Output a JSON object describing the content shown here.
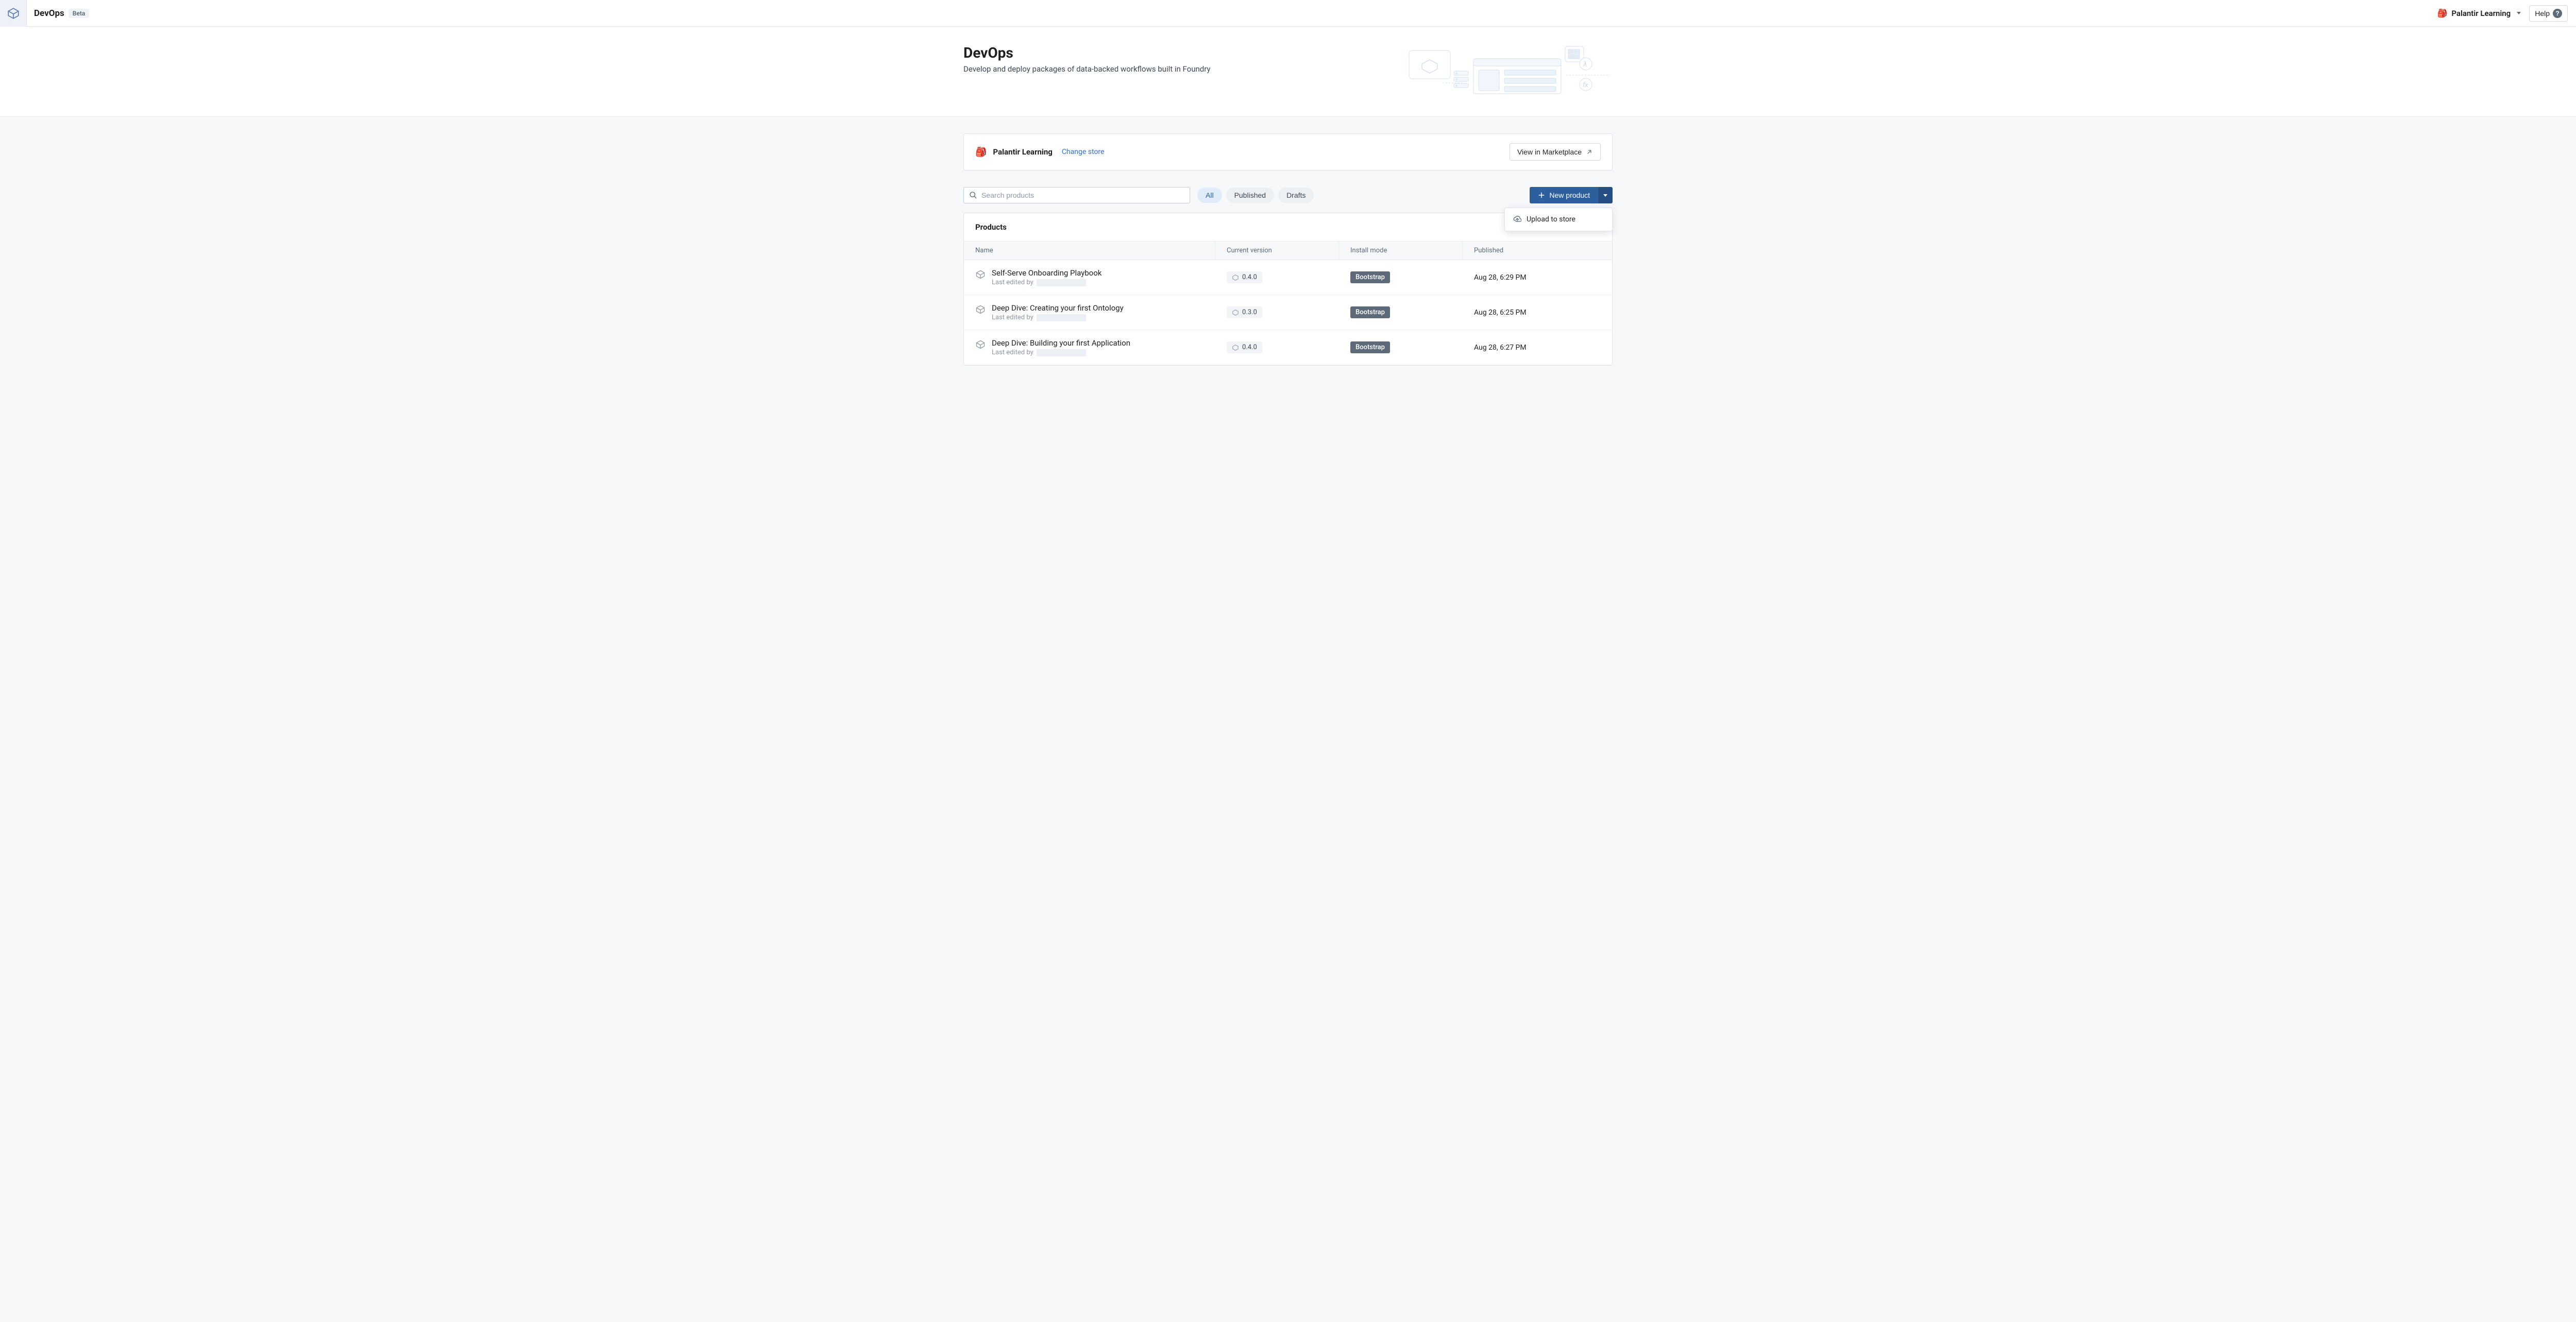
{
  "header": {
    "app_name": "DevOps",
    "beta_label": "Beta",
    "org_name": "Palantir Learning",
    "help_label": "Help"
  },
  "hero": {
    "title": "DevOps",
    "subtitle": "Develop and deploy packages of data-backed workflows built in Foundry"
  },
  "store_banner": {
    "store_name": "Palantir Learning",
    "change_store_label": "Change store",
    "view_marketplace_label": "View in Marketplace"
  },
  "toolbar": {
    "search_placeholder": "Search products",
    "filters": {
      "all": "All",
      "published": "Published",
      "drafts": "Drafts"
    },
    "new_product_label": "New product",
    "dropdown": {
      "upload_label": "Upload to store"
    }
  },
  "products": {
    "section_title": "Products",
    "columns": {
      "name": "Name",
      "version": "Current version",
      "install": "Install mode",
      "published": "Published"
    },
    "last_edited_prefix": "Last edited by",
    "rows": [
      {
        "name": "Self-Serve Onboarding Playbook",
        "version": "0.4.0",
        "install_mode": "Bootstrap",
        "published": "Aug 28, 6:29 PM"
      },
      {
        "name": "Deep Dive: Creating your first Ontology",
        "version": "0.3.0",
        "install_mode": "Bootstrap",
        "published": "Aug 28, 6:25 PM"
      },
      {
        "name": "Deep Dive: Building your first Application",
        "version": "0.4.0",
        "install_mode": "Bootstrap",
        "published": "Aug 28, 6:27 PM"
      }
    ]
  },
  "colors": {
    "primary": "#2d5f9e",
    "link": "#2d72d2",
    "chip_bg": "#5c6a7a"
  }
}
